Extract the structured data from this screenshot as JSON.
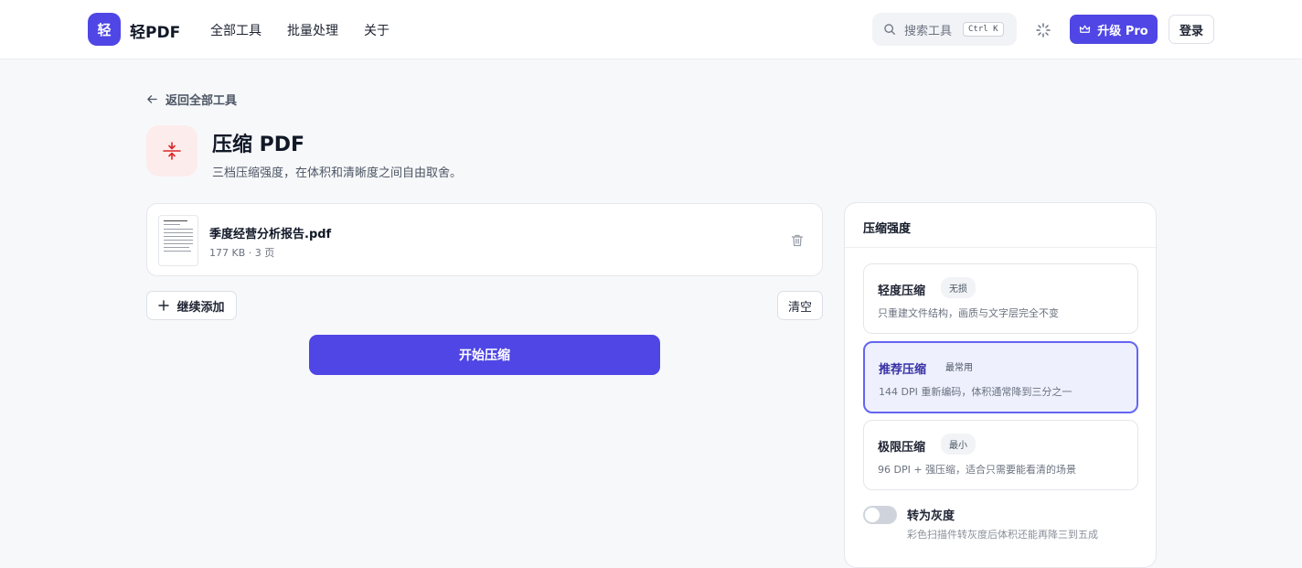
{
  "header": {
    "logo_char": "轻",
    "app_name": "轻PDF",
    "nav": [
      "全部工具",
      "批量处理",
      "关于"
    ],
    "search_placeholder": "搜索工具",
    "search_shortcut": "Ctrl K",
    "upgrade_label": "升级 Pro",
    "login_label": "登录"
  },
  "page": {
    "back_label": "返回全部工具",
    "title": "压缩 PDF",
    "subtitle": "三档压缩强度，在体积和清晰度之间自由取舍。"
  },
  "file": {
    "name": "季度经营分析报告.pdf",
    "meta": "177 KB · 3 页"
  },
  "actions": {
    "add_label": "继续添加",
    "clear_label": "清空",
    "start_label": "开始压缩"
  },
  "panel": {
    "title": "压缩强度",
    "options": [
      {
        "name": "轻度压缩",
        "tag": "无损",
        "desc": "只重建文件结构，画质与文字层完全不变",
        "selected": false
      },
      {
        "name": "推荐压缩",
        "tag": "最常用",
        "desc": "144 DPI 重新编码，体积通常降到三分之一",
        "selected": true
      },
      {
        "name": "极限压缩",
        "tag": "最小",
        "desc": "96 DPI + 强压缩，适合只需要能看清的场景",
        "selected": false
      }
    ],
    "grayscale_label": "转为灰度",
    "grayscale_desc": "彩色扫描件转灰度后体积还能再降三到五成",
    "grayscale_on": false
  },
  "colors": {
    "accent": "#4f46e5",
    "tool_icon": "#dc2626",
    "tool_icon_bg": "#fdecec"
  },
  "icons": {
    "search": "search-icon",
    "theme": "loader-icon",
    "crown": "crown-icon",
    "back": "arrow-left-icon",
    "tool": "compress-icon",
    "trash": "trash-icon",
    "plus": "plus-icon"
  }
}
